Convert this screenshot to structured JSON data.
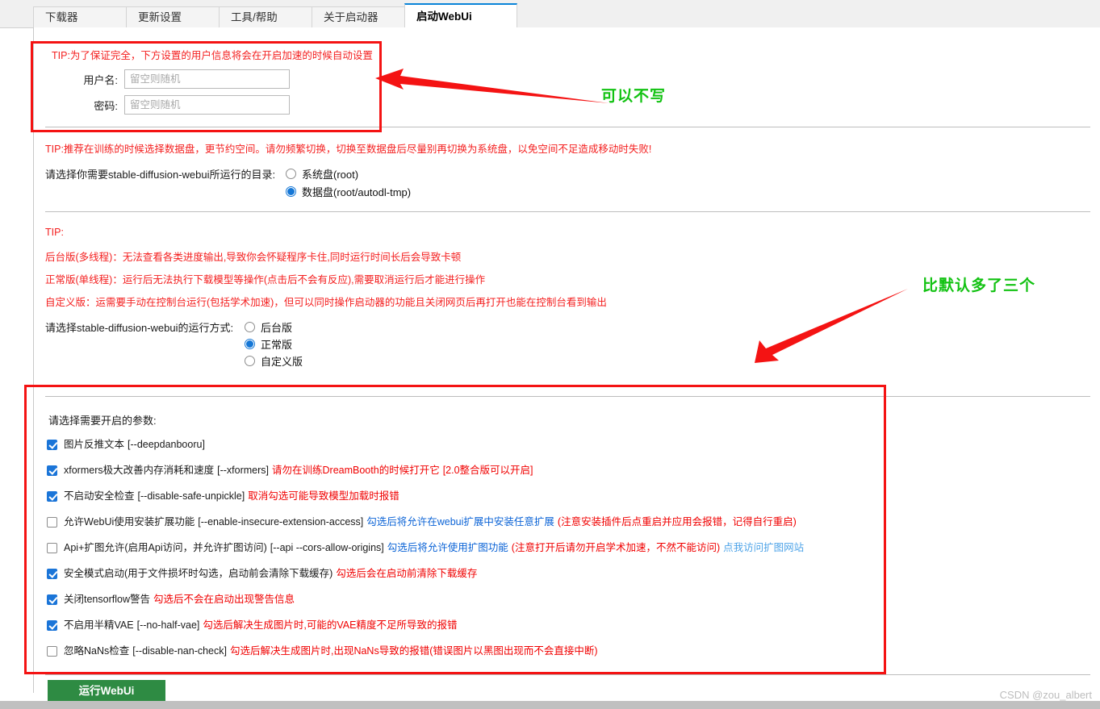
{
  "window": {
    "tabs": [
      {
        "label": "下载器",
        "active": false
      },
      {
        "label": "更新设置",
        "active": false
      },
      {
        "label": "工具/帮助",
        "active": false
      },
      {
        "label": "关于启动器",
        "active": false
      },
      {
        "label": "启动WebUi",
        "active": true
      }
    ]
  },
  "auth_section": {
    "tip": "TIP:为了保证完全，下方设置的用户信息将会在开启加速的时候自动设置",
    "username_label": "用户名:",
    "username_value": "",
    "username_placeholder": "留空则随机",
    "password_label": "密码:",
    "password_value": "",
    "password_placeholder": "留空则随机"
  },
  "dir_section": {
    "tip": "TIP:推荐在训练的时候选择数据盘，更节约空间。请勿频繁切换，切换至数据盘后尽量别再切换为系统盘，以免空间不足造成移动时失败!",
    "prompt": "请选择你需要stable-diffusion-webui所运行的目录:",
    "options": [
      {
        "label": "系统盘(root)",
        "selected": false
      },
      {
        "label": "数据盘(root/autodl-tmp)",
        "selected": true
      }
    ]
  },
  "mode_section": {
    "tip_title": "TIP:",
    "tip_lines": [
      "后台版(多线程)：无法查看各类进度输出,导致你会怀疑程序卡住,同时运行时间长后会导致卡顿",
      "正常版(单线程)：运行后无法执行下载模型等操作(点击后不会有反应),需要取消运行后才能进行操作",
      "自定义版：运需要手动在控制台运行(包括学术加速)，但可以同时操作启动器的功能且关闭网页后再打开也能在控制台看到输出"
    ],
    "prompt": "请选择stable-diffusion-webui的运行方式:",
    "options": [
      {
        "label": "后台版",
        "selected": false
      },
      {
        "label": "正常版",
        "selected": true
      },
      {
        "label": "自定义版",
        "selected": false
      }
    ]
  },
  "params_section": {
    "prompt": "请选择需要开启的参数:",
    "items": [
      {
        "checked": true,
        "parts": [
          {
            "text": "图片反推文本",
            "color": "blk"
          },
          {
            "text": "[--deepdanbooru]",
            "color": "blk"
          }
        ]
      },
      {
        "checked": true,
        "parts": [
          {
            "text": "xformers极大改善内存消耗和速度",
            "color": "blk"
          },
          {
            "text": "[--xformers]",
            "color": "blk"
          },
          {
            "text": "请勿在训练DreamBooth的时候打开它",
            "color": "redtxt"
          },
          {
            "text": "[2.0整合版可以开启]",
            "color": "redtxt"
          }
        ]
      },
      {
        "checked": true,
        "parts": [
          {
            "text": "不启动安全检查",
            "color": "blk"
          },
          {
            "text": "[--disable-safe-unpickle]",
            "color": "blk"
          },
          {
            "text": "取消勾选可能导致模型加载时报错",
            "color": "redtxt"
          }
        ]
      },
      {
        "checked": false,
        "parts": [
          {
            "text": "允许WebUi使用安装扩展功能",
            "color": "blk"
          },
          {
            "text": "[--enable-insecure-extension-access]",
            "color": "blk"
          },
          {
            "text": "勾选后将允许在webui扩展中安装任意扩展",
            "color": "blue"
          },
          {
            "text": "(注意安装插件后点重启并应用会报错，记得自行重启)",
            "color": "redtxt"
          }
        ]
      },
      {
        "checked": false,
        "parts": [
          {
            "text": "Api+扩图允许(启用Api访问，并允许扩图访问)",
            "color": "blk"
          },
          {
            "text": "[--api --cors-allow-origins]",
            "color": "blk"
          },
          {
            "text": "勾选后将允许使用扩图功能",
            "color": "blue"
          },
          {
            "text": "(注意打开后请勿开启学术加速，不然不能访问)",
            "color": "redtxt"
          },
          {
            "text": "点我访问扩图网站",
            "color": "lblue"
          }
        ]
      },
      {
        "checked": true,
        "parts": [
          {
            "text": "安全模式启动(用于文件损坏时勾选，启动前会清除下载缓存)",
            "color": "blk"
          },
          {
            "text": "勾选后会在启动前清除下载缓存",
            "color": "redtxt"
          }
        ]
      },
      {
        "checked": true,
        "parts": [
          {
            "text": "关闭tensorflow警告",
            "color": "blk"
          },
          {
            "text": "勾选后不会在启动出现警告信息",
            "color": "redtxt"
          }
        ]
      },
      {
        "checked": true,
        "parts": [
          {
            "text": "不启用半精VAE",
            "color": "blk"
          },
          {
            "text": "[--no-half-vae]",
            "color": "blk"
          },
          {
            "text": "勾选后解决生成图片时,可能的VAE精度不足所导致的报错",
            "color": "redtxt"
          }
        ]
      },
      {
        "checked": false,
        "parts": [
          {
            "text": "忽略NaNs检查",
            "color": "blk"
          },
          {
            "text": "[--disable-nan-check]",
            "color": "blk"
          },
          {
            "text": "勾选后解决生成图片时,出现NaNs导致的报错(错误图片以黑图出现而不会直接中断)",
            "color": "redtxt"
          }
        ]
      }
    ]
  },
  "footer": {
    "run_button": "运行WebUi",
    "watermark": "CSDN @zou_albert"
  },
  "annotations": {
    "note_top": "可以不写",
    "note_bottom": "比默认多了三个",
    "color_highlight": "#f41313",
    "color_note": "#12c212"
  }
}
